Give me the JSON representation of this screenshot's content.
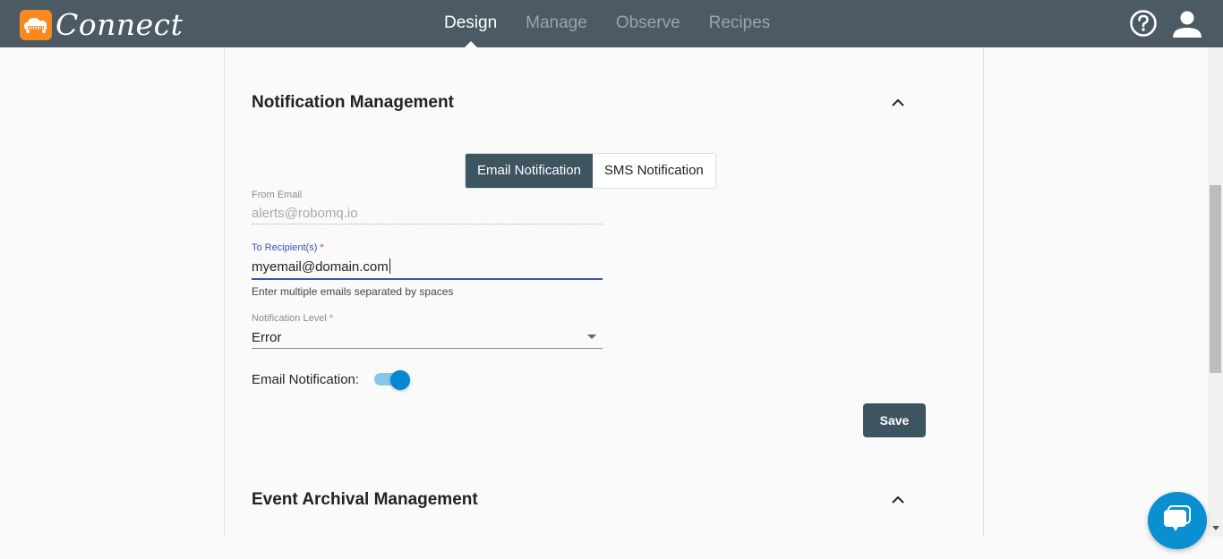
{
  "app": {
    "name": "Connect",
    "logo_icon": "cloud-jeep-logo-icon",
    "brand_color": "#f7891f",
    "header_color": "#4c5a64"
  },
  "nav": {
    "items": [
      {
        "label": "Design",
        "active": true
      },
      {
        "label": "Manage",
        "active": false
      },
      {
        "label": "Observe",
        "active": false
      },
      {
        "label": "Recipes",
        "active": false
      }
    ],
    "help_icon": "help-circle-icon",
    "user_icon": "user-account-icon"
  },
  "notification_section": {
    "title": "Notification Management",
    "collapse_icon": "chevron-up-icon",
    "tabs": [
      {
        "label": "Email Notification",
        "active": true
      },
      {
        "label": "SMS Notification",
        "active": false
      }
    ],
    "from_email": {
      "label": "From Email",
      "value": "alerts@robomq.io"
    },
    "to_recipients": {
      "label": "To Recipient(s)",
      "required_mark": "*",
      "value": "myemail@domain.com",
      "hint": "Enter multiple emails separated by spaces"
    },
    "notification_level": {
      "label": "Notification Level *",
      "value": "Error"
    },
    "email_toggle": {
      "label": "Email Notification:",
      "enabled": true
    },
    "save_label": "Save",
    "accent_color": "#3d5561"
  },
  "archival_section": {
    "title": "Event Archival Management",
    "collapse_icon": "chevron-up-icon"
  },
  "chat_widget": {
    "icon": "chat-bubbles-icon",
    "color": "#0a8fd1"
  }
}
